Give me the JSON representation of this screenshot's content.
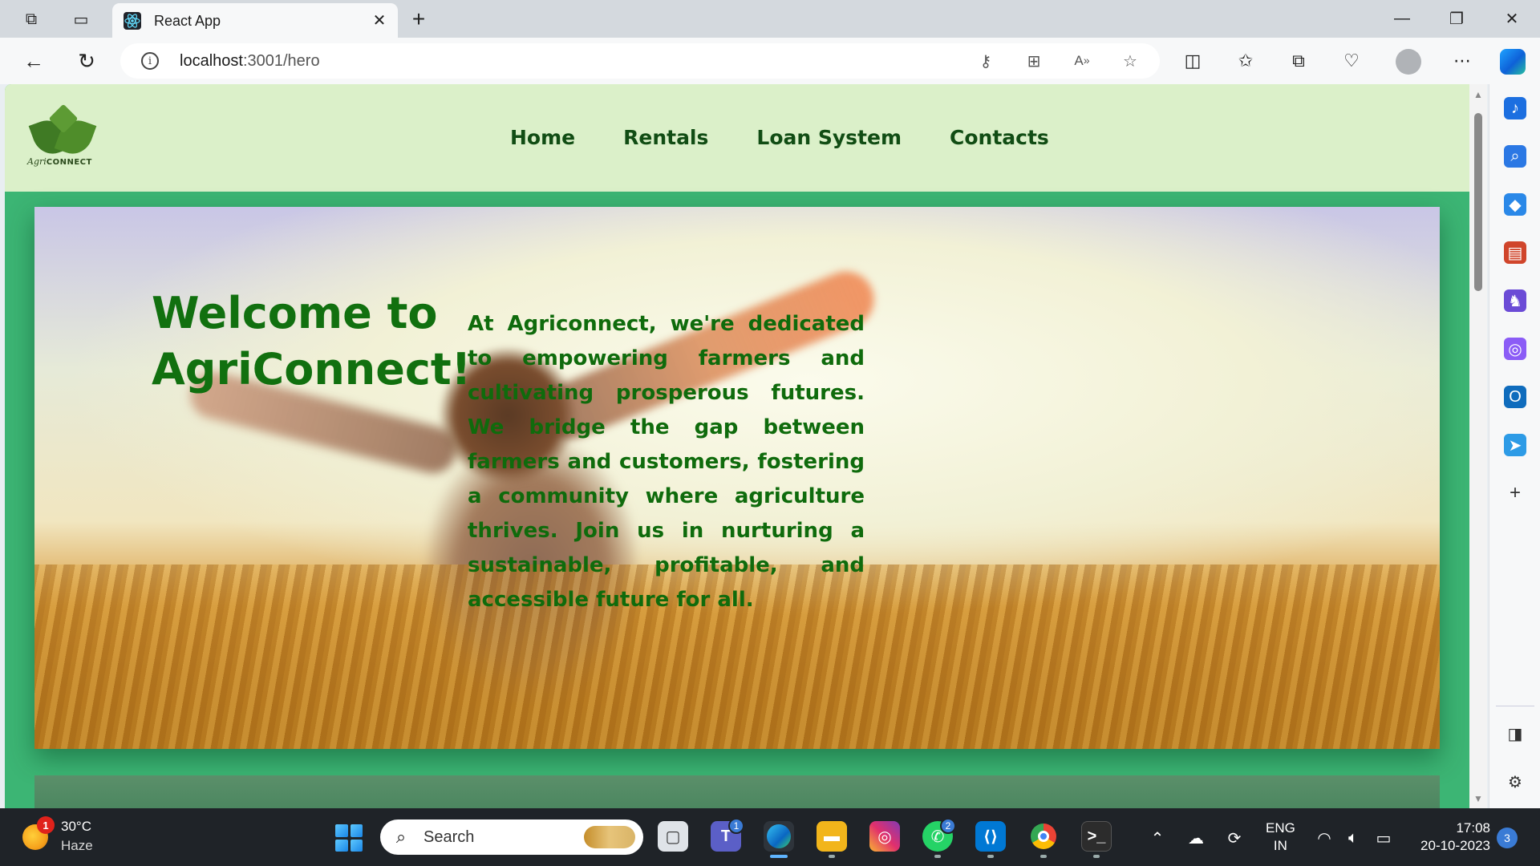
{
  "browser": {
    "tab": {
      "title": "React App",
      "favicon": "react-icon",
      "close_icon": "close-icon"
    },
    "new_tab_icon": "plus-icon",
    "window_controls": [
      "minimize-icon",
      "restore-icon",
      "close-icon"
    ],
    "address": {
      "host": "localhost",
      "path": ":3001/hero",
      "info_icon": "info-icon"
    },
    "omnibox_icons": [
      "key-icon",
      "extensions-icon",
      "read-aloud-icon",
      "favorite-star-icon"
    ],
    "toolbar_icons": [
      "split-screen-icon",
      "favorites-icon",
      "collections-icon",
      "performance-icon",
      "profile-avatar",
      "more-icon",
      "copilot-icon"
    ],
    "sidebar_icons": [
      "notifications-icon",
      "search-icon",
      "shopping-icon",
      "tools-icon",
      "games-icon",
      "microsoft-365-icon",
      "outlook-icon",
      "send-icon",
      "add-icon",
      "hide-sidebar-icon",
      "settings-icon"
    ]
  },
  "site": {
    "logo": {
      "script": "Agri",
      "word": "CONNECT"
    },
    "nav": [
      {
        "label": "Home"
      },
      {
        "label": "Rentals"
      },
      {
        "label": "Loan System"
      },
      {
        "label": "Contacts"
      }
    ],
    "hero": {
      "title": "Welcome to AgriConnect!",
      "description": "At Agriconnect, we're dedicated to empowering farmers and cultivating prosperous futures. We bridge the gap between farmers and customers, fostering a community where agriculture thrives. Join us in nurturing a sustainable, profitable, and accessible future for all."
    },
    "colors": {
      "header_bg": "#dbf0c9",
      "page_bg": "#3cb574",
      "nav_text": "#114d14",
      "hero_text": "#11700f"
    }
  },
  "taskbar": {
    "weather": {
      "temp": "30°C",
      "condition": "Haze",
      "badge": "1"
    },
    "search": {
      "label": "Search"
    },
    "apps": [
      {
        "name": "task-view-icon",
        "badge": ""
      },
      {
        "name": "teams-icon",
        "badge": "1"
      },
      {
        "name": "edge-icon",
        "badge": ""
      },
      {
        "name": "file-explorer-icon",
        "badge": ""
      },
      {
        "name": "instagram-icon",
        "badge": ""
      },
      {
        "name": "whatsapp-icon",
        "badge": "2"
      },
      {
        "name": "vscode-icon",
        "badge": ""
      },
      {
        "name": "chrome-icon",
        "badge": ""
      },
      {
        "name": "terminal-icon",
        "badge": ""
      }
    ],
    "tray": {
      "lang_top": "ENG",
      "lang_bottom": "IN",
      "time": "17:08",
      "date": "20-10-2023",
      "notification_count": "3"
    }
  }
}
